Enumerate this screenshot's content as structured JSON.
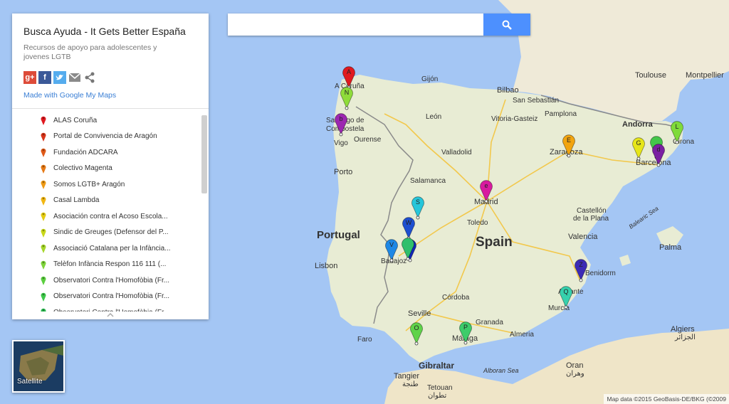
{
  "search": {
    "placeholder": "",
    "button_icon": "search-icon"
  },
  "panel": {
    "title": "Busca Ayuda - It Gets Better España",
    "description": "Recursos de apoyo para adolescentes y jovenes LGTB",
    "share_icons": [
      "google-plus-icon",
      "facebook-icon",
      "twitter-icon",
      "email-icon",
      "share-icon"
    ],
    "made_with": "Made with Google My Maps",
    "items": [
      {
        "label": "ALAS Coruña",
        "color": "#e0191f"
      },
      {
        "label": "Portal de Convivencia de Aragón",
        "color": "#d8351a"
      },
      {
        "label": "Fundación ADCARA",
        "color": "#e05a18"
      },
      {
        "label": "Colectivo Magenta",
        "color": "#e67a16"
      },
      {
        "label": "Somos LGTB+ Aragón",
        "color": "#ef9a14"
      },
      {
        "label": "Casal Lambda",
        "color": "#f2b713"
      },
      {
        "label": "Asociación contra el Acoso Escola...",
        "color": "#e5cc12"
      },
      {
        "label": "Sindic de Greuges (Defensor del P...",
        "color": "#c9d81a"
      },
      {
        "label": "Associació Catalana per la Infància...",
        "color": "#a5d62a"
      },
      {
        "label": "Telèfon Infància Respon 116 111 (...",
        "color": "#7fd43a"
      },
      {
        "label": "Observatori Contra l'Homofòbia (Fr...",
        "color": "#5bcf3f"
      },
      {
        "label": "Observatori Contra l'Homofòbia (Fr...",
        "color": "#3ec84a"
      },
      {
        "label": "Observatori Contra l'Homofòbia (Fr...",
        "color": "#2fbf55"
      }
    ]
  },
  "map": {
    "water_labels": [
      "Balearic Sea",
      "Alboran Sea"
    ],
    "country_labels": [
      "Portugal",
      "Spain"
    ],
    "region_labels": [
      "Andorra"
    ],
    "cities": [
      "A Coruña",
      "Gijón",
      "Bilbao",
      "San Sebastián",
      "Toulouse",
      "Montpellier",
      "Santiago de Compostela",
      "León",
      "Pamplona",
      "Vitoria-Gasteiz",
      "Vigo",
      "Ourense",
      "Valladolid",
      "Zaragoza",
      "Girona",
      "Porto",
      "Barcelona",
      "Salamanca",
      "Madrid",
      "Castellón de la Plana",
      "Toledo",
      "Valencia",
      "Palma",
      "Lisbon",
      "Badajoz",
      "Alicante",
      "Benidorm",
      "Córdoba",
      "Murcia",
      "Seville",
      "Granada",
      "Algiers",
      "الجزائر",
      "Almeria",
      "Faro",
      "Málaga",
      "Gibraltar",
      "Oran",
      "وهران",
      "Tangier",
      "طنجة",
      "Tetouan",
      "تطوان"
    ],
    "markers": [
      {
        "letter": "A",
        "color": "#e0191f"
      },
      {
        "letter": "N",
        "color": "#8fdc3a"
      },
      {
        "letter": "b",
        "color": "#9c27b0"
      },
      {
        "letter": "E",
        "color": "#f2a40f"
      },
      {
        "letter": "G",
        "color": "#e6e619"
      },
      {
        "letter": "L",
        "color": "#7fdb3a"
      },
      {
        "letter": "",
        "color": "#43c64a"
      },
      {
        "letter": "d",
        "color": "#7b1fa2"
      },
      {
        "letter": "e",
        "color": "#d81b9f"
      },
      {
        "letter": "S",
        "color": "#26c6da"
      },
      {
        "letter": "W",
        "color": "#1e4fd0"
      },
      {
        "letter": "V",
        "color": "#1e88e5"
      },
      {
        "letter": "X",
        "color": "#1226b8"
      },
      {
        "letter": "",
        "color": "#2fbf6c"
      },
      {
        "letter": "Z",
        "color": "#3d2bb5"
      },
      {
        "letter": "Q",
        "color": "#36d1ad"
      },
      {
        "letter": "O",
        "color": "#5fd34a"
      },
      {
        "letter": "P",
        "color": "#3dcc6a"
      }
    ]
  },
  "satellite": {
    "label": "Satellite"
  },
  "attribution": "Map data ©2015 GeoBasis-DE/BKG (©2009"
}
